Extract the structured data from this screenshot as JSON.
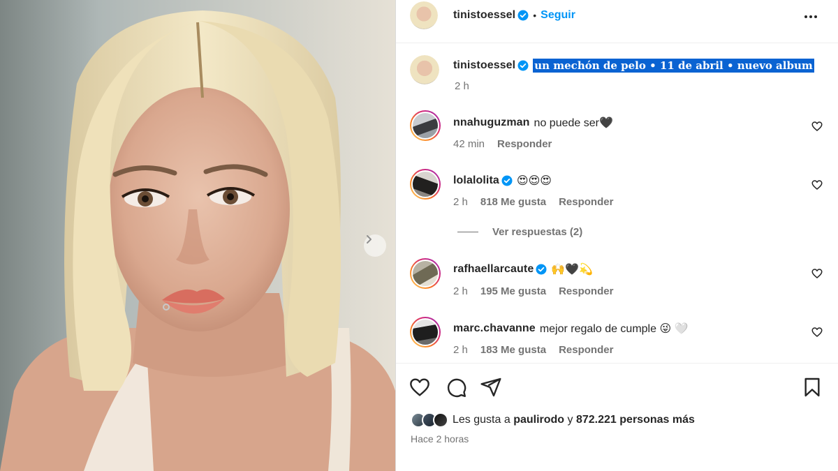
{
  "post": {
    "author": "tinistoessel",
    "follow_label": "Seguir",
    "separator": "•",
    "caption": "un mechón de pelo • 11 de abril • nuevo album",
    "caption_time": "2 h"
  },
  "comments": [
    {
      "user": "nnahuguzman",
      "verified": false,
      "text": "no puede ser🖤",
      "time": "42 min",
      "likes": "",
      "reply": "Responder"
    },
    {
      "user": "lolalolita",
      "verified": true,
      "text": "😍😍😍",
      "time": "2 h",
      "likes": "818 Me gusta",
      "reply": "Responder"
    },
    {
      "user": "rafhaellarcaute",
      "verified": true,
      "text": "🙌🖤💫",
      "time": "2 h",
      "likes": "195 Me gusta",
      "reply": "Responder"
    },
    {
      "user": "marc.chavanne",
      "verified": false,
      "text": "mejor regalo de cumple 😜 🤍",
      "time": "2 h",
      "likes": "183 Me gusta",
      "reply": "Responder"
    }
  ],
  "view_replies": "Ver respuestas (2)",
  "likes": {
    "prefix": "Les gusta a",
    "user": "paulirodo",
    "connector": "y",
    "count": "872.221 personas más"
  },
  "posted_ago": "Hace 2 horas",
  "icons": [
    "more-icon",
    "verified-icon",
    "heart-icon",
    "comment-icon",
    "share-icon",
    "bookmark-icon",
    "chevron-right-icon"
  ],
  "colors": {
    "accent": "#0095f6",
    "selection": "#0a63d2",
    "secondary_text": "#737373"
  }
}
